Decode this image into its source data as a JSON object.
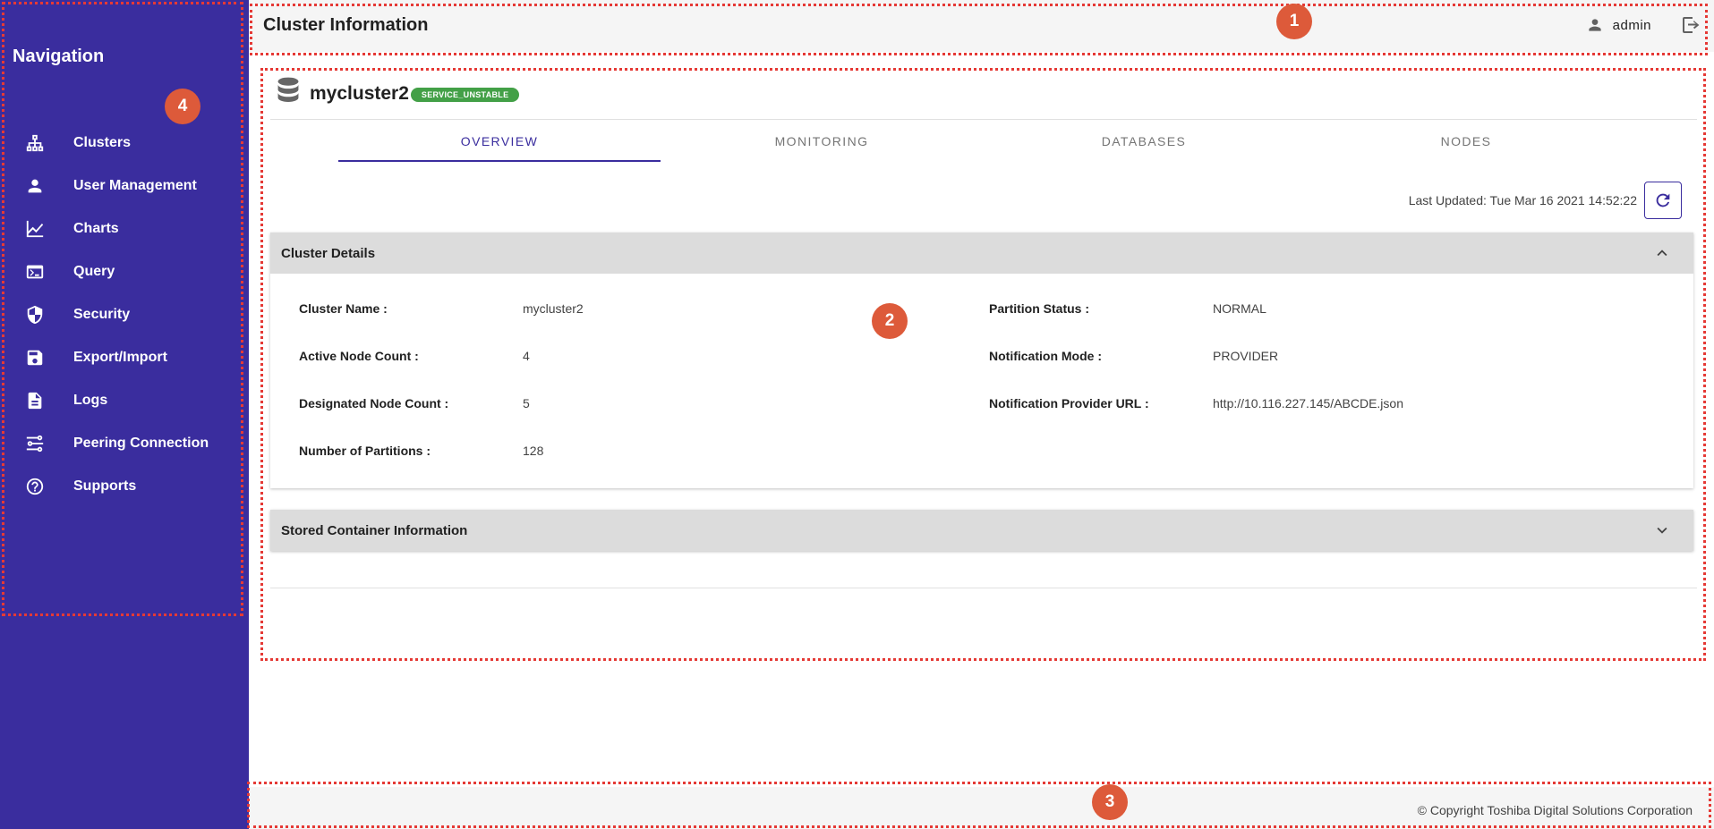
{
  "sidebar": {
    "title": "Navigation",
    "items": [
      {
        "label": "Clusters",
        "icon": "sitemap-icon"
      },
      {
        "label": "User Management",
        "icon": "person-icon"
      },
      {
        "label": "Charts",
        "icon": "line-chart-icon"
      },
      {
        "label": "Query",
        "icon": "terminal-icon"
      },
      {
        "label": "Security",
        "icon": "shield-icon"
      },
      {
        "label": "Export/Import",
        "icon": "save-icon"
      },
      {
        "label": "Logs",
        "icon": "document-icon"
      },
      {
        "label": "Peering Connection",
        "icon": "peering-icon"
      },
      {
        "label": "Supports",
        "icon": "help-icon"
      }
    ]
  },
  "header": {
    "title": "Cluster Information",
    "username": "admin"
  },
  "cluster": {
    "name": "mycluster2",
    "status": "SERVICE_UNSTABLE",
    "status_color": "#43a047"
  },
  "tabs": [
    "OVERVIEW",
    "MONITORING",
    "DATABASES",
    "NODES"
  ],
  "last_updated": "Last Updated: Tue Mar 16 2021 14:52:22",
  "details_panel": {
    "title": "Cluster Details",
    "left": [
      {
        "label": "Cluster Name :",
        "value": "mycluster2"
      },
      {
        "label": "Active Node Count :",
        "value": "4"
      },
      {
        "label": "Designated Node Count :",
        "value": "5"
      },
      {
        "label": "Number of Partitions :",
        "value": "128"
      }
    ],
    "right": [
      {
        "label": "Partition Status :",
        "value": "NORMAL"
      },
      {
        "label": "Notification Mode :",
        "value": "PROVIDER"
      },
      {
        "label": "Notification Provider URL :",
        "value": "http://10.116.227.145/ABCDE.json"
      }
    ]
  },
  "stored_panel": {
    "title": "Stored Container Information"
  },
  "footer": {
    "copyright": "© Copyright Toshiba Digital Solutions Corporation"
  },
  "annotations": [
    "1",
    "2",
    "3",
    "4"
  ],
  "colors": {
    "accent": "#3a2d9e",
    "annotation": "#dd5a3a",
    "callout_border": "#e53935"
  }
}
